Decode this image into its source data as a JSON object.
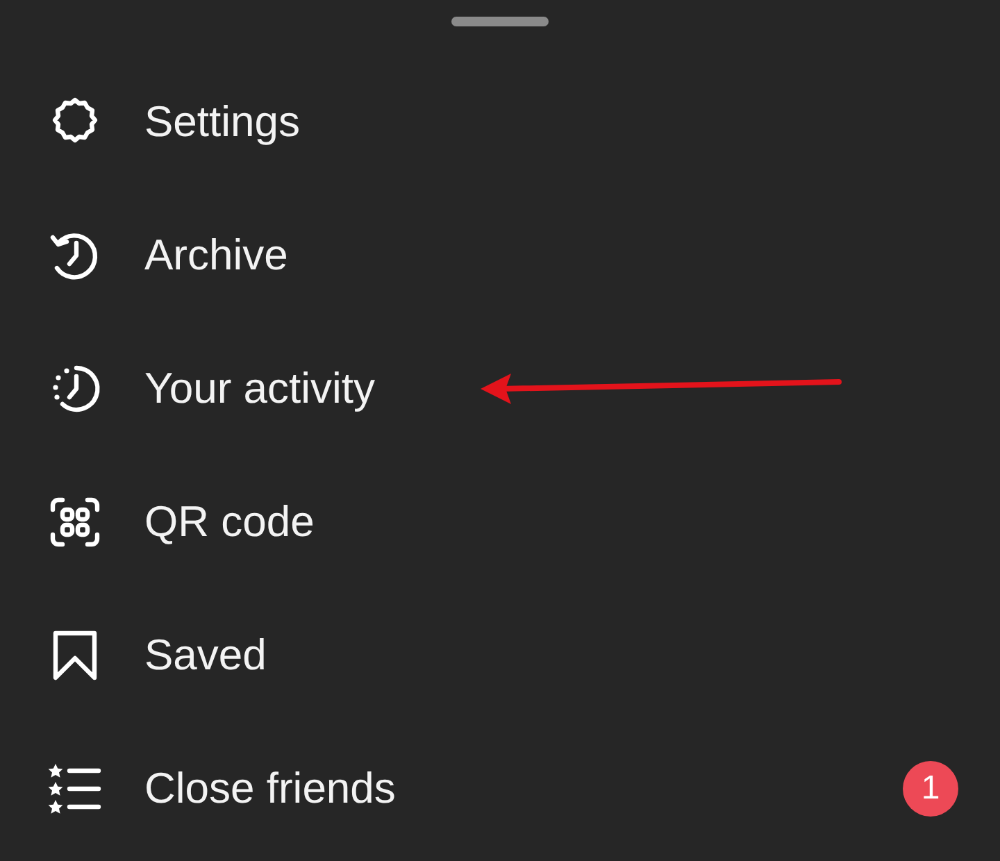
{
  "menu": {
    "items": [
      {
        "kind": "settings",
        "label": "Settings"
      },
      {
        "kind": "archive",
        "label": "Archive"
      },
      {
        "kind": "activity",
        "label": "Your activity"
      },
      {
        "kind": "qr",
        "label": "QR code"
      },
      {
        "kind": "saved",
        "label": "Saved"
      },
      {
        "kind": "close-friends",
        "label": "Close friends",
        "badge": "1"
      }
    ]
  }
}
